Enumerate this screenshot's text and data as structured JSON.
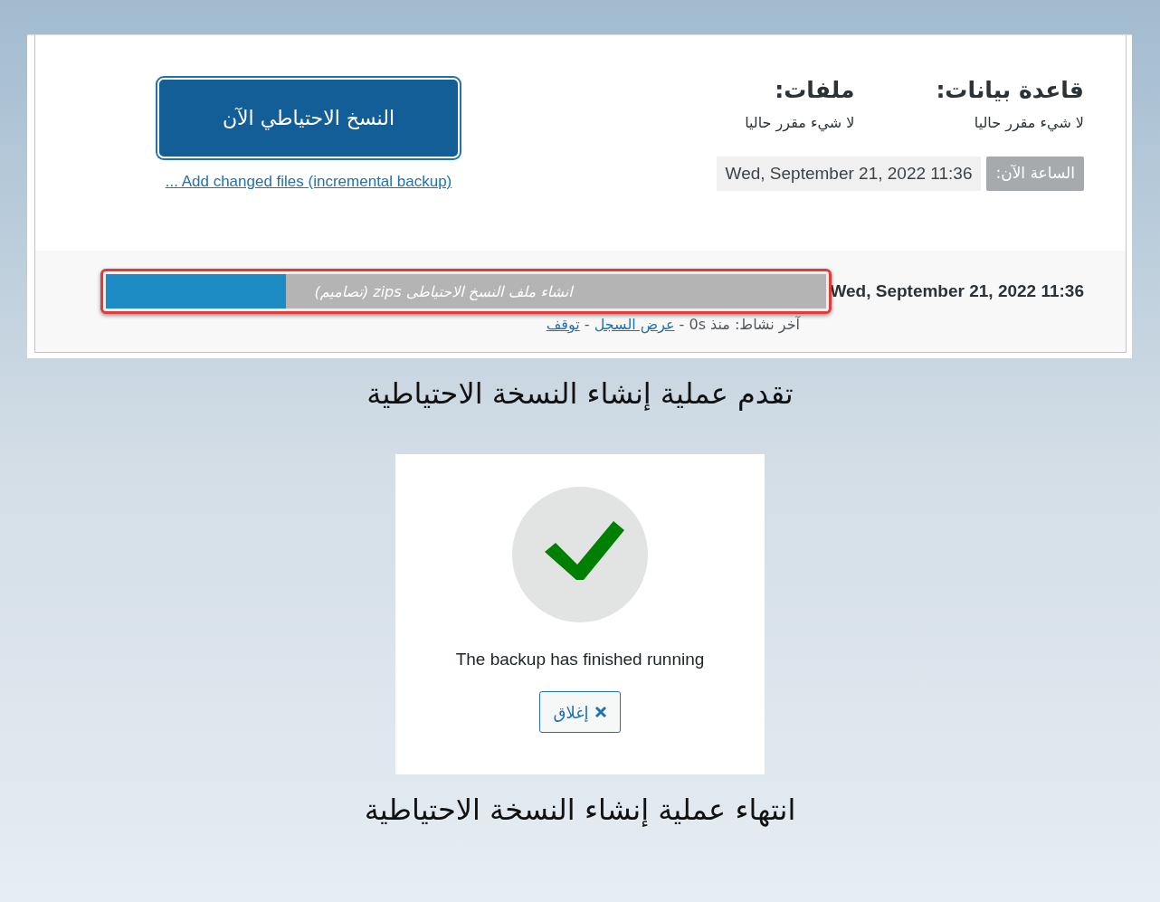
{
  "panel": {
    "schedule": [
      {
        "heading": "قاعدة بيانات:",
        "value": "لا شيء مقرر حاليا"
      },
      {
        "heading": "ملفات:",
        "value": "لا شيء مقرر حاليا"
      }
    ],
    "time_label": "الساعة الآن:",
    "time_value": "Wed, September 21, 2022 11:36",
    "backup_button": "النسخ الاحتياطي الآن",
    "incremental_link": "... Add changed files (incremental backup)",
    "progress": {
      "started": "Wed, September 21, 2022 11:36",
      "level": 0.25,
      "status": "انشاء ملف النسخ الاحتياطى zips (تصاميم)",
      "activity": "آخر نشاط: منذ 0s -",
      "log_link": "عرض السجل",
      "separator": "-",
      "stop_link": "توقف"
    }
  },
  "caption_1": "تقدم عملية إنشاء النسخة الاحتياطية",
  "dialog": {
    "message": "The backup has finished running",
    "close_button": "إغلاق"
  },
  "caption_2": "انتهاء عملية إنشاء النسخة الاحتياطية"
}
